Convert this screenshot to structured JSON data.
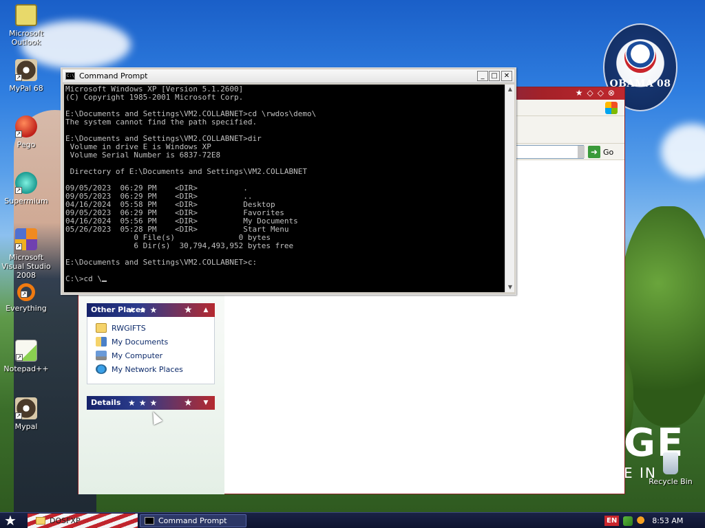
{
  "desktop": {
    "icons": [
      {
        "label": "Microsoft Outlook"
      },
      {
        "label": "MyPal 68"
      },
      {
        "label": "Pego"
      },
      {
        "label": "Supermium"
      },
      {
        "label": "Microsoft Visual Studio 2008"
      },
      {
        "label": "Everything"
      },
      {
        "label": "Notepad++"
      },
      {
        "label": "Mypal"
      },
      {
        "label": "Recycle Bin"
      }
    ],
    "wallpaper": {
      "logo_text": "OBAMA'08",
      "big_text": "GE",
      "sub_text": "E IN"
    }
  },
  "cmd_window": {
    "title": "Command Prompt",
    "icon_text": "C:\\",
    "buttons": {
      "minimize": "_",
      "maximize": "□",
      "close": "✕"
    },
    "console_lines": [
      "Microsoft Windows XP [Version 5.1.2600]",
      "(C) Copyright 1985-2001 Microsoft Corp.",
      "",
      "E:\\Documents and Settings\\VM2.COLLABNET>cd \\rwdos\\demo\\",
      "The system cannot find the path specified.",
      "",
      "E:\\Documents and Settings\\VM2.COLLABNET>dir",
      " Volume in drive E is Windows XP",
      " Volume Serial Number is 6837-72E8",
      "",
      " Directory of E:\\Documents and Settings\\VM2.COLLABNET",
      "",
      "09/05/2023  06:29 PM    <DIR>          .",
      "09/05/2023  06:29 PM    <DIR>          ..",
      "04/16/2024  05:58 PM    <DIR>          Desktop",
      "09/05/2023  06:29 PM    <DIR>          Favorites",
      "04/16/2024  05:56 PM    <DIR>          My Documents",
      "05/26/2023  05:28 PM    <DIR>          Start Menu",
      "               0 File(s)              0 bytes",
      "               6 Dir(s)  30,794,493,952 bytes free",
      "",
      "E:\\Documents and Settings\\VM2.COLLABNET>c:",
      ""
    ],
    "current_input": "C:\\>cd \\"
  },
  "explorer": {
    "go_label": "Go",
    "other_places": {
      "header": "Other Places",
      "items": [
        "RWGIFTS",
        "My Documents",
        "My Computer",
        "My Network Places"
      ]
    },
    "details": {
      "header": "Details"
    }
  },
  "taskbar": {
    "folder_button": "DOSFXP",
    "cmd_button": "Command Prompt",
    "language": "EN",
    "clock": "8:53 AM"
  },
  "colors": {
    "console_bg": "#000000",
    "console_fg": "#c0c0c0",
    "taskbar_bg": "#0e1430",
    "panel_blue": "#16236a",
    "panel_red": "#b52a30"
  }
}
